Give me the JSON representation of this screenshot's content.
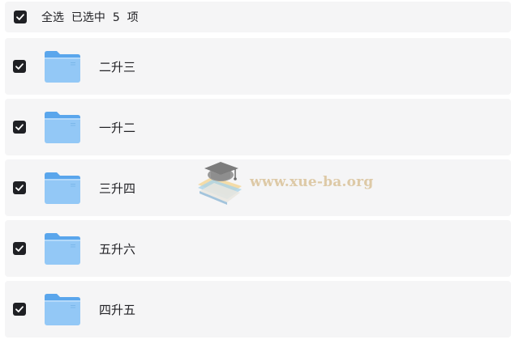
{
  "header": {
    "select_all_label": "全选",
    "selected_prefix": "已选中",
    "selected_count": "5",
    "selected_suffix": "项"
  },
  "items": [
    {
      "label": "二升三",
      "checked": true
    },
    {
      "label": "一升二",
      "checked": true
    },
    {
      "label": "三升四",
      "checked": true
    },
    {
      "label": "五升六",
      "checked": true
    },
    {
      "label": "四升五",
      "checked": true
    }
  ],
  "icons": {
    "checkbox": "checkbox-checked-icon",
    "folder": "folder-icon",
    "watermark": "graduation-cap-logo"
  },
  "watermark": {
    "text": "www.xue-ba.org"
  },
  "colors": {
    "row_background": "#f5f5f6",
    "checkbox_fill": "#1f2024",
    "folder_blue": "#64aff0",
    "watermark_text": "#ddc9a6"
  }
}
